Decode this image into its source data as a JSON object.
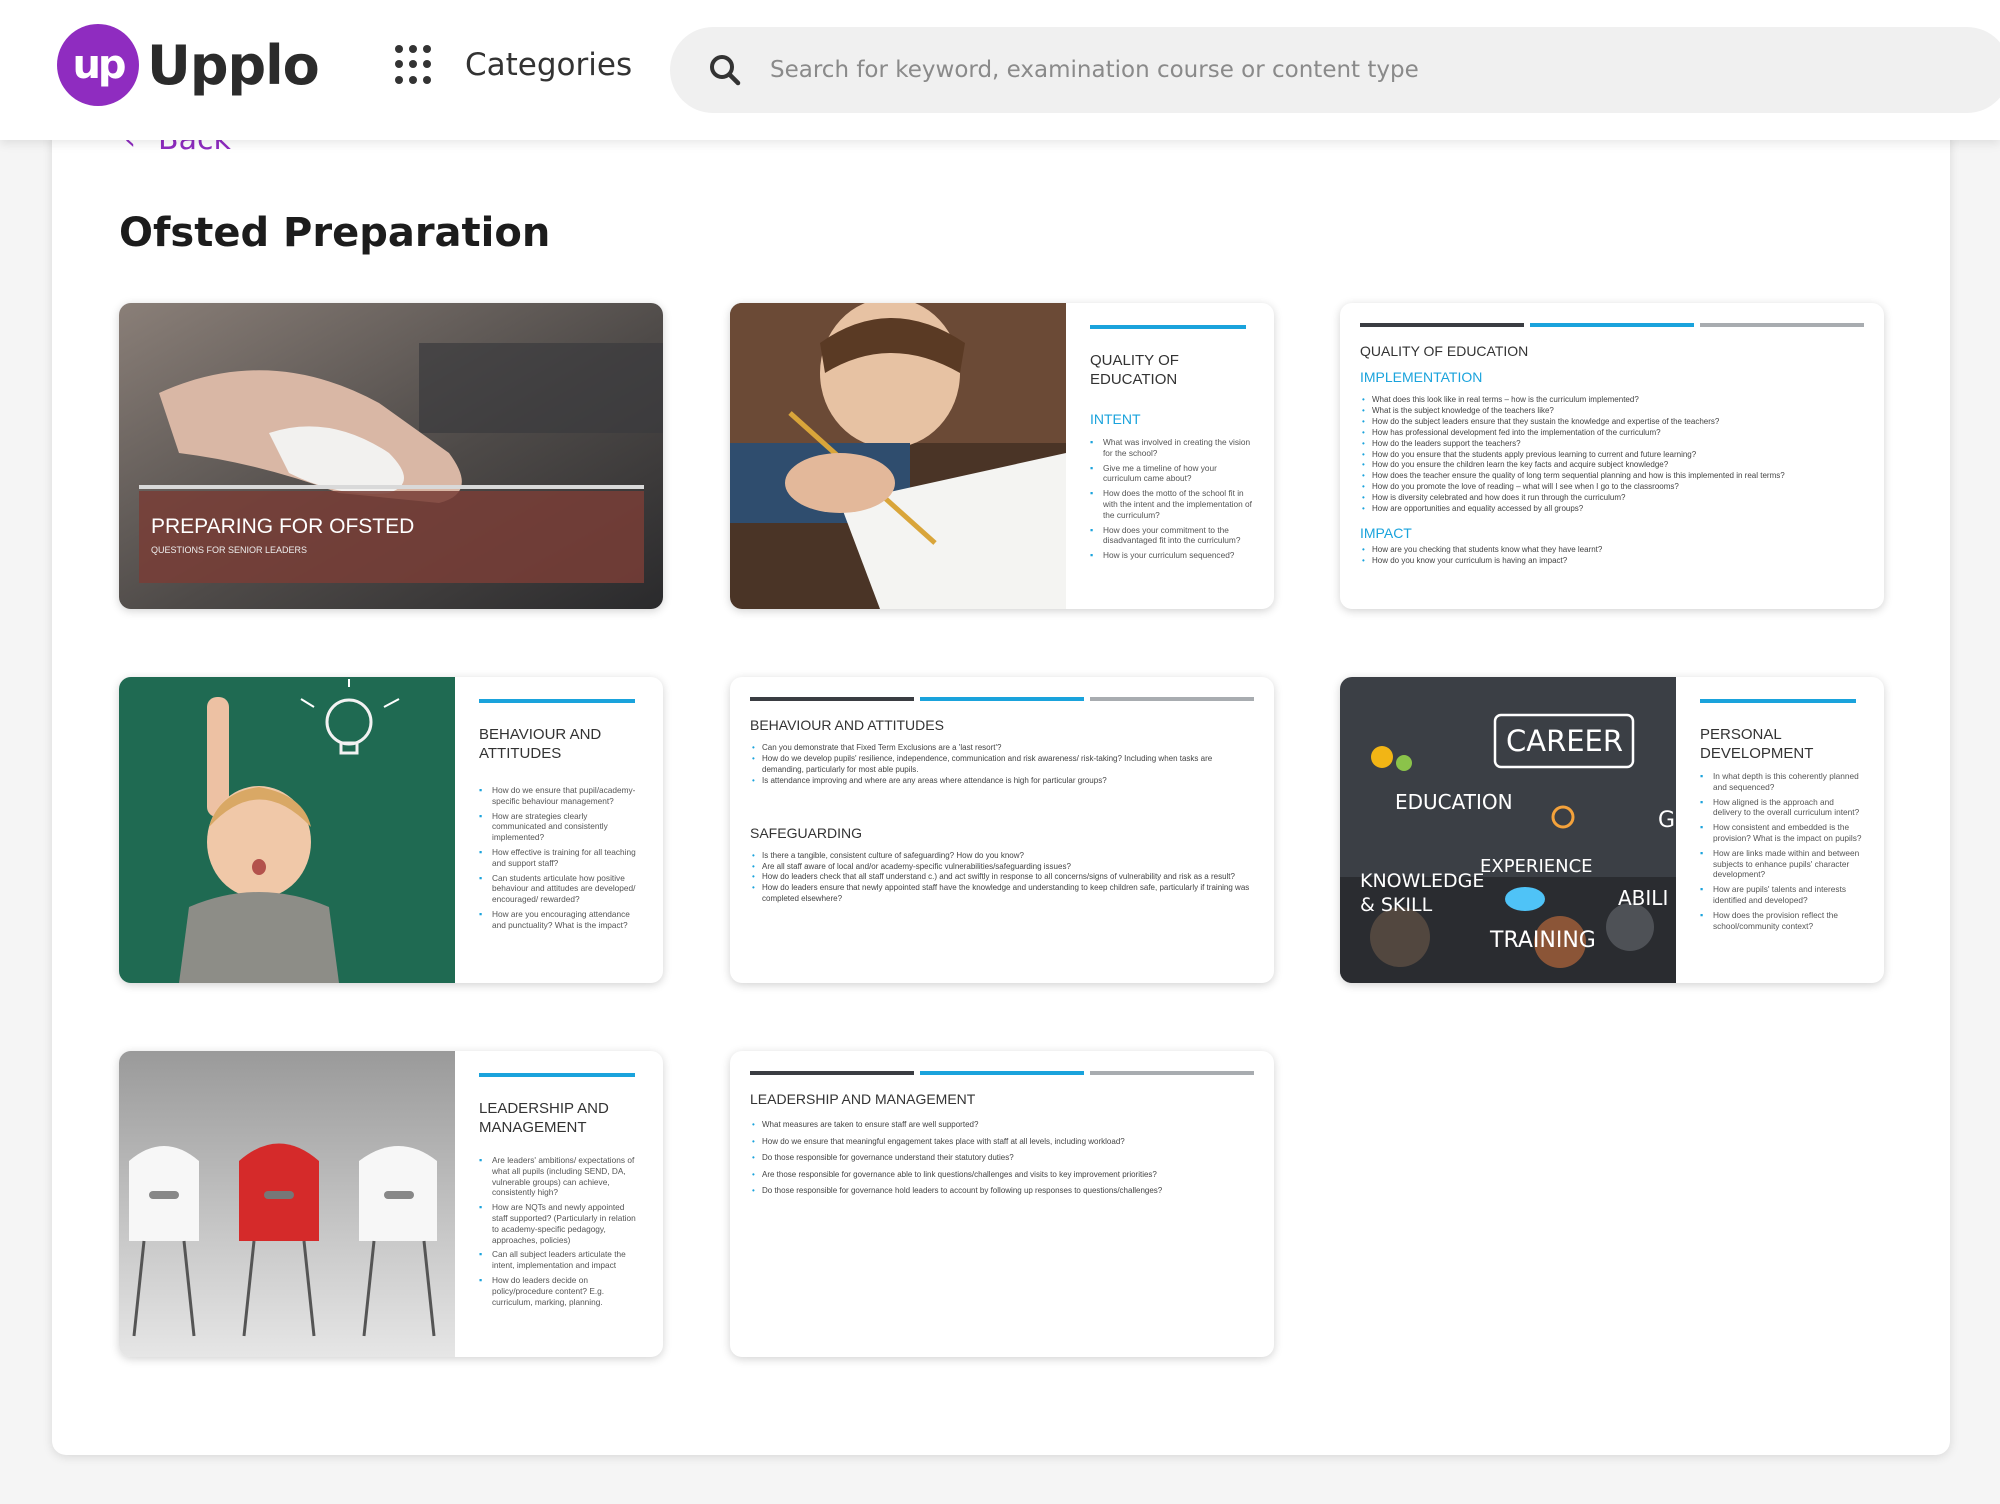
{
  "brand": {
    "logo_mark": "up",
    "name": "Upplo",
    "color": "#8f2cc0"
  },
  "header": {
    "categories_label": "Categories",
    "categories_icon": "grid-dots-icon",
    "search_icon": "search-icon",
    "search_placeholder": "Search for keyword, examination course or content type"
  },
  "page": {
    "back_label": "Back",
    "title": "Ofsted Preparation"
  },
  "accent_colors": {
    "blue": "#1aa3dc",
    "dark": "#3a3d42",
    "grey": "#a8acb0"
  },
  "slides": [
    {
      "title": "PREPARING FOR OFSTED",
      "subtitle": "QUESTIONS FOR SENIOR LEADERS"
    },
    {
      "title": "QUALITY OF EDUCATION",
      "subtitle": "INTENT",
      "items": [
        "What was involved in creating the vision for the school?",
        "Give me a timeline of how your curriculum came about?",
        "How does the motto of the school fit in with the intent and the implementation of the curriculum?",
        "How does your commitment to the disadvantaged fit into the curriculum?",
        "How is your curriculum sequenced?"
      ]
    },
    {
      "title": "QUALITY OF EDUCATION",
      "sections": [
        {
          "heading": "IMPLEMENTATION",
          "items": [
            "What does this look like in real terms – how is the curriculum implemented?",
            "What is the subject knowledge of the teachers like?",
            "How do the subject leaders ensure that they sustain the knowledge and expertise of the teachers?",
            "How has professional development fed into the implementation of the curriculum?",
            "How do the leaders support the teachers?",
            "How do you ensure that the students apply previous learning to current and future learning?",
            "How do you ensure the children learn the key facts and acquire subject knowledge?",
            "How does the teacher ensure the quality of long term sequential planning and how is this implemented in real terms?",
            "How do you promote the love of reading – what will I see when I go to the classrooms?",
            "How is diversity celebrated and how does it run through the curriculum?",
            "How are opportunities and equality accessed by all groups?"
          ]
        },
        {
          "heading": "IMPACT",
          "items": [
            "How are you checking that students know what they have learnt?",
            "How do you know your curriculum is having an impact?"
          ]
        }
      ]
    },
    {
      "title": "BEHAVIOUR AND ATTITUDES",
      "items": [
        "How do we ensure that pupil/academy-specific behaviour management?",
        "How are strategies clearly communicated and consistently implemented?",
        "How effective is training for all teaching and support staff?",
        "Can students articulate how positive behaviour and attitudes are developed/ encouraged/ rewarded?",
        "How are you encouraging attendance and punctuality? What is the impact?"
      ]
    },
    {
      "sections": [
        {
          "heading": "BEHAVIOUR AND ATTITUDES",
          "items": [
            "Can you demonstrate that Fixed Term Exclusions are a 'last resort'?",
            "How do we develop pupils' resilience, independence, communication and risk awareness/ risk-taking? Including when tasks are demanding, particularly for most able pupils.",
            "Is attendance improving and where are any areas where attendance is high for particular groups?"
          ]
        },
        {
          "heading": "SAFEGUARDING",
          "items": [
            "Is there a tangible, consistent culture of safeguarding? How do you know?",
            "Are all staff aware of local and/or academy-specific vulnerabilities/safeguarding issues?",
            "How do leaders check that all staff understand c.) and act swiftly in response to all concerns/signs of vulnerability and risk as a result?",
            "How do leaders ensure that newly appointed staff have the knowledge and understanding to keep children safe, particularly if training was completed elsewhere?"
          ]
        }
      ]
    },
    {
      "title": "PERSONAL DEVELOPMENT",
      "image_words": [
        "CAREER",
        "EDUCATION",
        "EXPERIENCE",
        "KNOWLEDGE",
        "& SKILL",
        "ABILI",
        "TRAINING",
        "G"
      ],
      "items": [
        "In what depth is this coherently planned and sequenced?",
        "How aligned is the approach and delivery to the overall curriculum intent?",
        "How consistent and embedded is the provision? What is the impact on pupils?",
        "How are links made within and between subjects to enhance pupils' character development?",
        "How are pupils' talents and interests identified and developed?",
        "How does the provision reflect the school/community context?"
      ]
    },
    {
      "title": "LEADERSHIP AND MANAGEMENT",
      "items": [
        "Are leaders' ambitions/ expectations of what all pupils (including SEND, DA, vulnerable groups) can achieve, consistently high?",
        "How are NQTs and newly appointed staff supported? (Particularly in relation to academy-specific pedagogy, approaches, policies)",
        "Can all subject leaders articulate the intent, implementation and impact",
        "How do leaders decide on policy/procedure content? E.g. curriculum, marking, planning."
      ]
    },
    {
      "title": "LEADERSHIP AND MANAGEMENT",
      "items": [
        "What measures are taken to ensure staff are well supported?",
        "How do we ensure that meaningful engagement takes place with staff at all levels, including workload?",
        "Do those responsible for governance understand their statutory duties?",
        "Are those responsible for governance able to link questions/challenges and visits to key improvement priorities?",
        "Do those responsible for governance hold leaders to account by following up responses to questions/challenges?"
      ]
    }
  ]
}
